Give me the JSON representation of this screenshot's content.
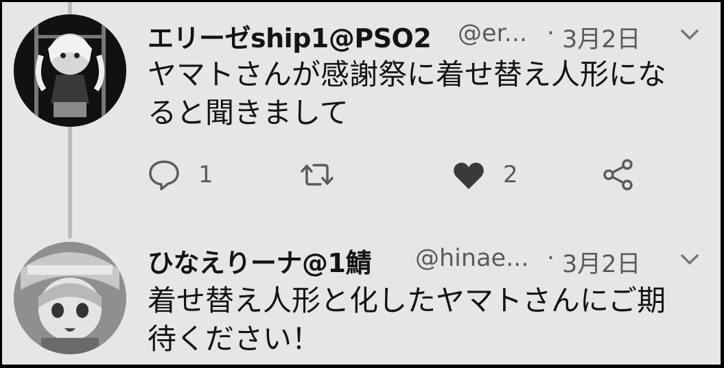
{
  "tweets": [
    {
      "display_name": "エリーゼship1@PSO2",
      "handle": "@er...",
      "separator": "·",
      "date": "3月2日",
      "text_lines": [
        "ヤマトさんが感謝祭に着せ替え人形にな",
        "ると聞きまして"
      ],
      "reply_count": "1",
      "retweet_count": "",
      "like_count": "2"
    },
    {
      "display_name": "ひなえりーナ@1鯖",
      "handle": "@hinae...",
      "separator": "·",
      "date": "3月2日",
      "text_lines": [
        "着せ替え人形と化したヤマトさんにご期",
        "待ください！"
      ]
    }
  ],
  "icons": {
    "reply": "speech-bubble-icon",
    "retweet": "retweet-arrows-icon",
    "like": "heart-icon",
    "share": "share-icon",
    "menu": "chevron-down-icon"
  },
  "colors": {
    "background": "#e6e6e6",
    "text": "#141414",
    "secondary": "#5a5a5a",
    "heart": "#3a3a3a",
    "thread_line": "#bdbdbd"
  }
}
